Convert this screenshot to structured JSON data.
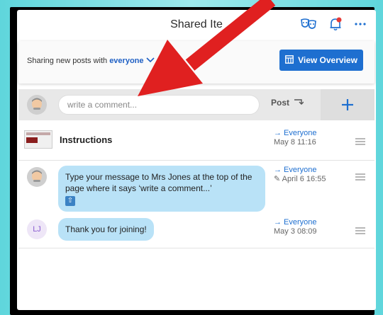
{
  "header": {
    "title": "Shared Ite"
  },
  "share_bar": {
    "prefix": "Sharing new posts with",
    "audience": "everyone",
    "view_button": "View Overview"
  },
  "composer": {
    "placeholder": "write a comment...",
    "post_label": "Post"
  },
  "items": [
    {
      "title": "Instructions",
      "to": "→ Everyone",
      "date": "May 8 11:16"
    },
    {
      "text": "Type your message to Mrs Jones at the top of the page where it says ‘write a comment...’",
      "to": "→ Everyone",
      "date": "April 6 16:55",
      "date_edit": "✎"
    },
    {
      "initials": "LJ",
      "text": "Thank you for joining!",
      "to": "→ Everyone",
      "date": "May 3 08:09"
    }
  ],
  "colors": {
    "accent": "#1e6fd0",
    "bubble": "#b9e2f7",
    "annotation_arrow": "#e02020"
  }
}
